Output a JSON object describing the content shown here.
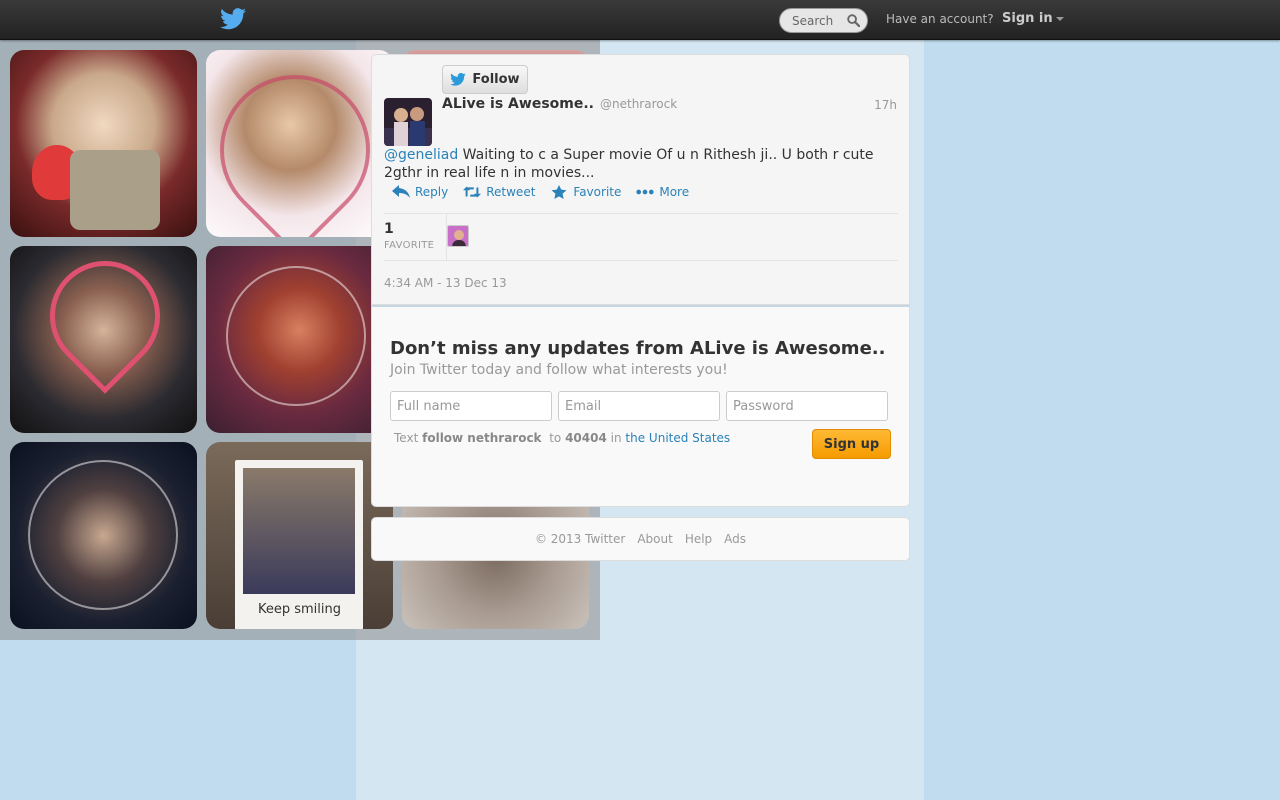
{
  "topbar": {
    "search_placeholder": "Search",
    "have_account": "Have an account?",
    "sign_in": "Sign in"
  },
  "photos": {
    "caption_keep_smiling": "Keep smiling"
  },
  "tweet": {
    "follow_label": "Follow",
    "user_name": "ALive is Awesome..",
    "screen_name": "@nethrarock",
    "timestamp": "17h",
    "mention": "@geneliad",
    "text": " Waiting to c a Super movie Of u n Rithesh ji.. U both r cute 2gthr in real life  n in movies...",
    "actions": {
      "reply": "Reply",
      "retweet": "Retweet",
      "favorite": "Favorite",
      "more": "More"
    },
    "favorite_count": "1",
    "favorite_label": "FAVORITE",
    "date": "4:34 AM - 13 Dec 13"
  },
  "signup": {
    "heading": "Don’t miss any updates from ALive is Awesome..",
    "subheading": "Join Twitter today and follow what interests you!",
    "full_name_placeholder": "Full name",
    "email_placeholder": "Email",
    "password_placeholder": "Password",
    "sms_text_prefix": "Text",
    "sms_command": "follow nethrarock",
    "sms_to": "to",
    "sms_number": "40404",
    "sms_in": "in",
    "sms_country": "the United States",
    "button": "Sign up"
  },
  "footer": {
    "copyright": "© 2013 Twitter",
    "about": "About",
    "help": "Help",
    "ads": "Ads"
  },
  "colors": {
    "link": "#2a82b8",
    "signup_button": "#f5a300",
    "page_background": "#c0dcee"
  }
}
